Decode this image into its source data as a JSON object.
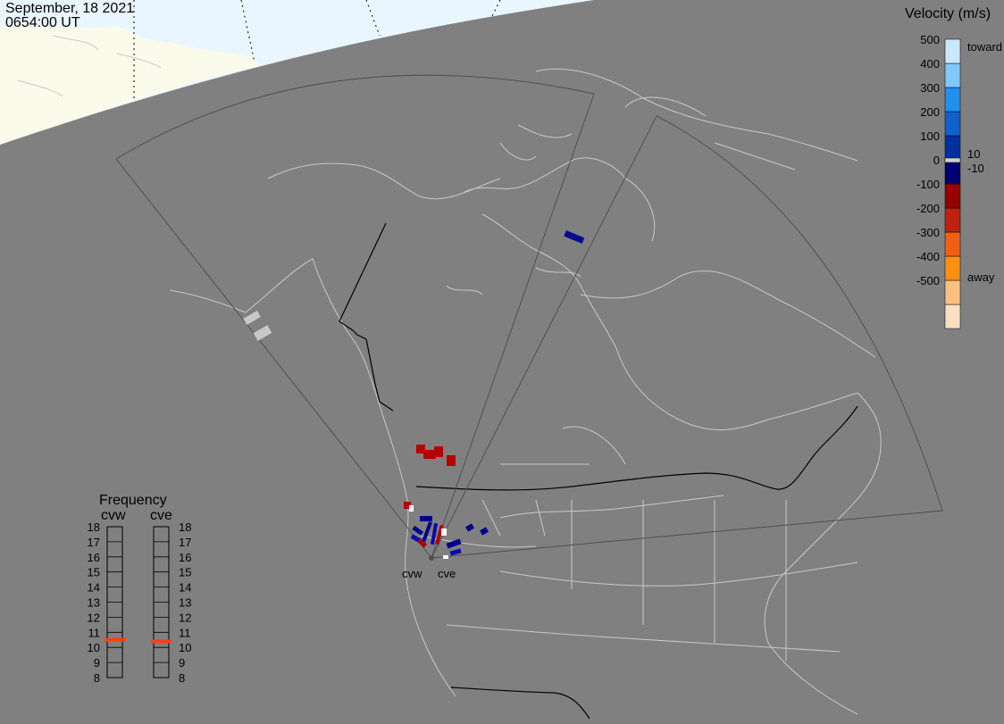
{
  "header": {
    "date": "September, 18 2021",
    "time": "0654:00 UT"
  },
  "colorbar": {
    "title": "Velocity (m/s)",
    "ticks": [
      "500",
      "400",
      "300",
      "200",
      "100",
      "0",
      "-100",
      "-200",
      "-300",
      "-400",
      "-500"
    ],
    "side_labels": {
      "toward": "toward",
      "pos_min": "10",
      "neg_min": "-10",
      "away": "away"
    },
    "colors": [
      "#fde0c0",
      "#fdc080",
      "#ff8f10",
      "#f06010",
      "#c02010",
      "#980000",
      "#000070",
      "#0030a0",
      "#1060d0",
      "#2090f0",
      "#80c8ff",
      "#c8e8ff"
    ]
  },
  "frequency": {
    "title": "Frequency",
    "radars": [
      "cvw",
      "cve"
    ],
    "ticks": [
      "18",
      "17",
      "16",
      "15",
      "14",
      "13",
      "12",
      "11",
      "10",
      "9",
      "8"
    ],
    "values_mhz": [
      10.5,
      10.4
    ],
    "marker_color": "#ff4010"
  },
  "radars": {
    "cvw": "cvw",
    "cve": "cve"
  },
  "colors": {
    "ground": "#808080",
    "sky": "#eaf6ff",
    "land": "#fbfbeb",
    "coast": "#c8c8c8",
    "border": "#000000",
    "fov": "#505050"
  }
}
